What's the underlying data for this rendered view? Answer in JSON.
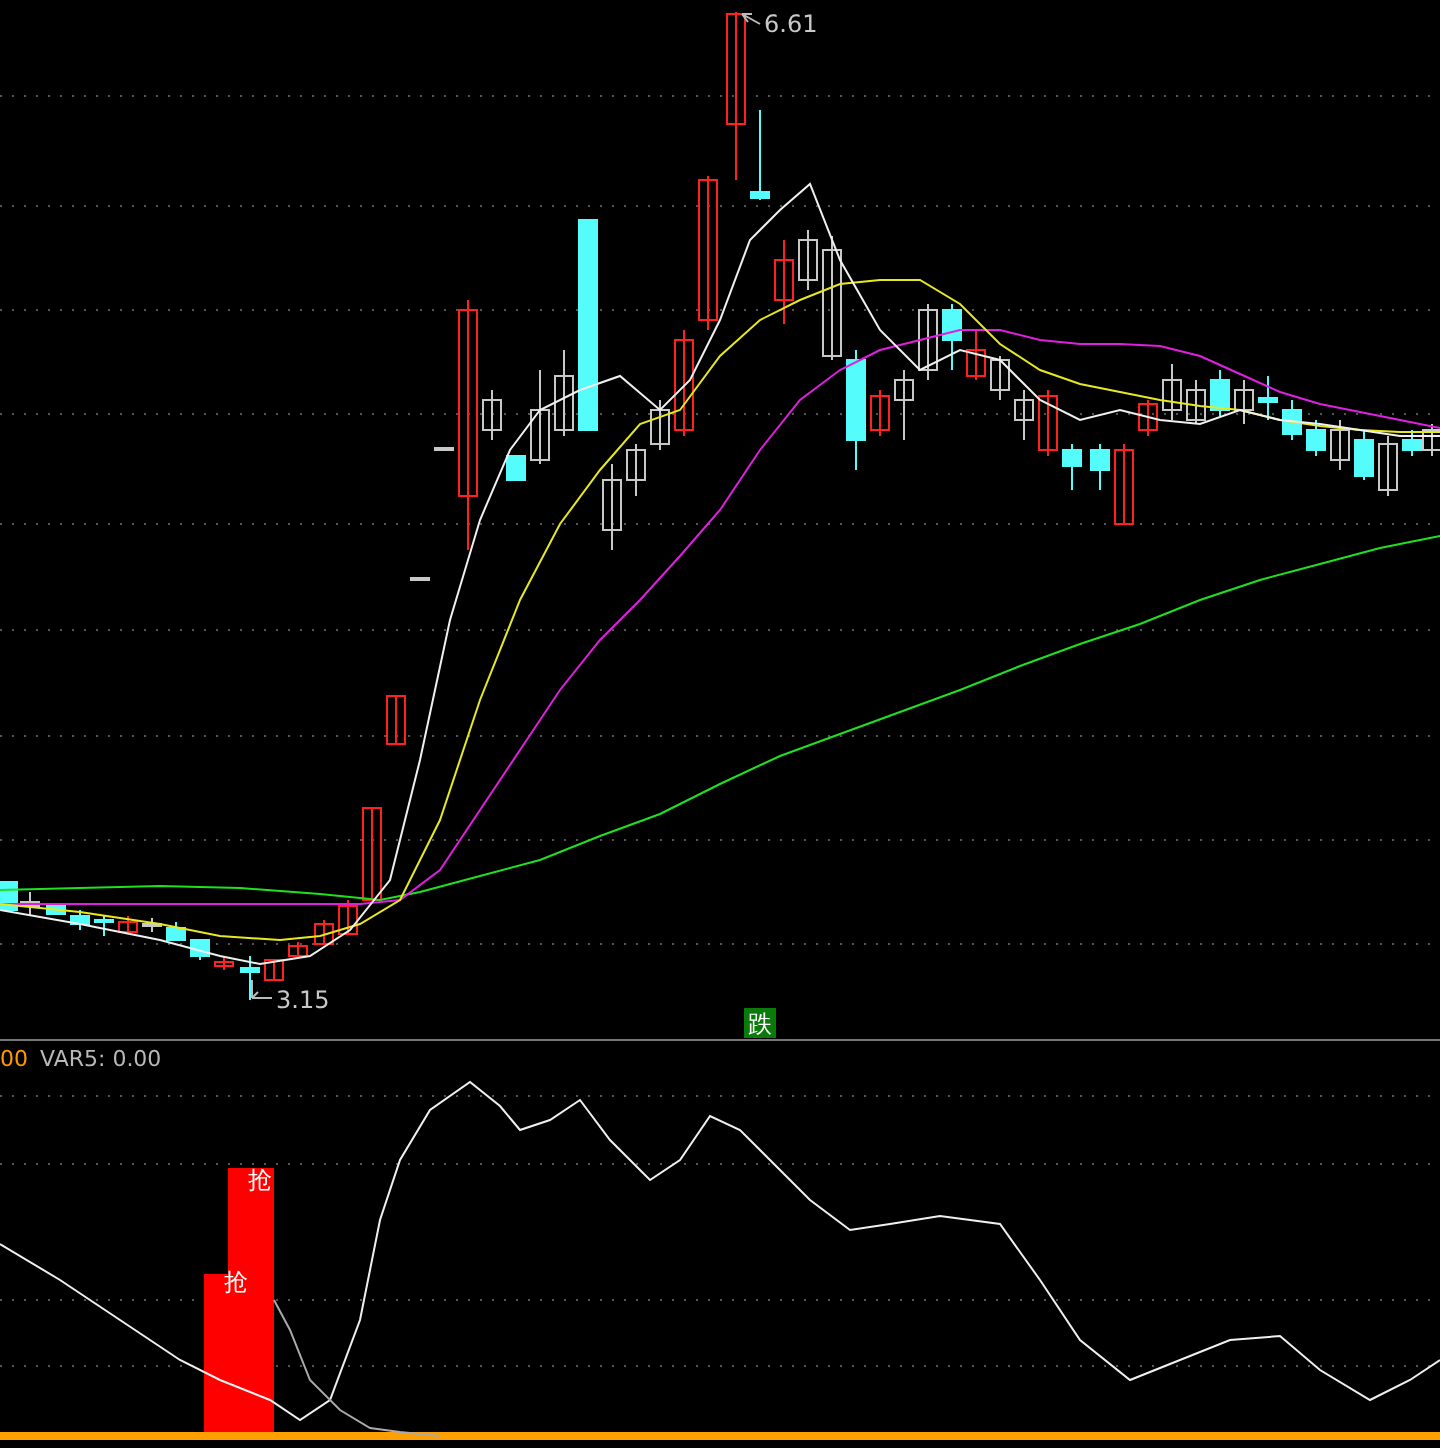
{
  "price_labels": [
    {
      "kind": "high",
      "text": "6.61"
    },
    {
      "kind": "low",
      "text": "3.15"
    }
  ],
  "signal_tag": "跌",
  "indicator_header": {
    "cut_value": "00",
    "var5": "VAR5: 0.00"
  },
  "bar_labels": [
    "抢",
    "抢"
  ]
}
